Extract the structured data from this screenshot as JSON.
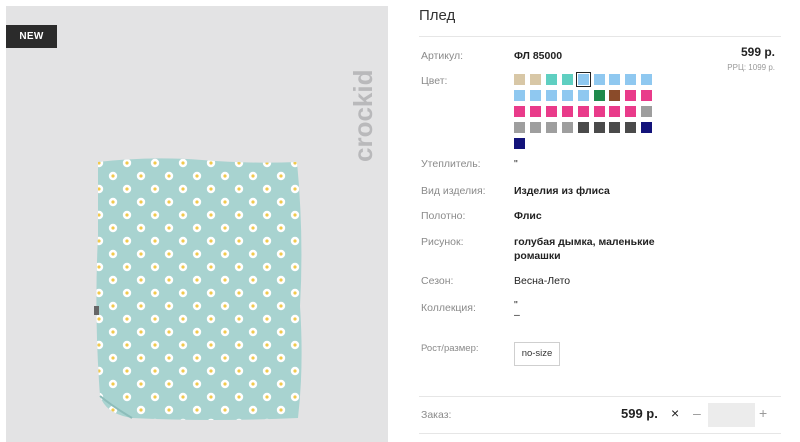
{
  "product": {
    "badge": "NEW",
    "brand": "crockid",
    "title": "Плед"
  },
  "details": {
    "article_label": "Артикул:",
    "article_value": "ФЛ 85000",
    "price": "599 р.",
    "rrp": "РРЦ: 1099 р.",
    "color_label": "Цвет:",
    "filling_label": "Утеплитель:",
    "filling_value": "\"",
    "type_label": "Вид изделия:",
    "type_value": "Изделия из флиса",
    "fabric_label": "Полотно:",
    "fabric_value": "Флис",
    "pattern_label": "Рисунок:",
    "pattern_value_1": "голубая дымка, маленькие",
    "pattern_value_2": "ромашки",
    "season_label": "Сезон:",
    "season_value": "Весна-Лето",
    "collection_label": "Коллекция:",
    "collection_value_1": "\"",
    "collection_value_2": "–",
    "size_label": "Рост/размер:",
    "size_value": "no-size"
  },
  "swatches": [
    "#d8c7a6",
    "#d8c7a6",
    "#5fcfc1",
    "#5fcfc1",
    "#8fc8f0",
    "#8fc8f0",
    "#8fc8f0",
    "#8fc8f0",
    "#8fc8f0",
    "#8fc8f0",
    "#8fc8f0",
    "#8fc8f0",
    "#8fc8f0",
    "#8fc8f0",
    "#1f8a4c",
    "#8a4b2a",
    "#e93b8a",
    "#e93b8a",
    "#e93b8a",
    "#e93b8a",
    "#e93b8a",
    "#e93b8a",
    "#e93b8a",
    "#e93b8a",
    "#e93b8a",
    "#e93b8a",
    "#9e9e9e",
    "#9e9e9e",
    "#9e9e9e",
    "#9e9e9e",
    "#9e9e9e",
    "#4a4a4a",
    "#4a4a4a",
    "#4a4a4a",
    "#4a4a4a",
    "#13137a",
    "#13137a"
  ],
  "order": {
    "label": "Заказ:",
    "price": "599 р.",
    "remove_icon": "×",
    "minus": "–",
    "plus": "+"
  }
}
